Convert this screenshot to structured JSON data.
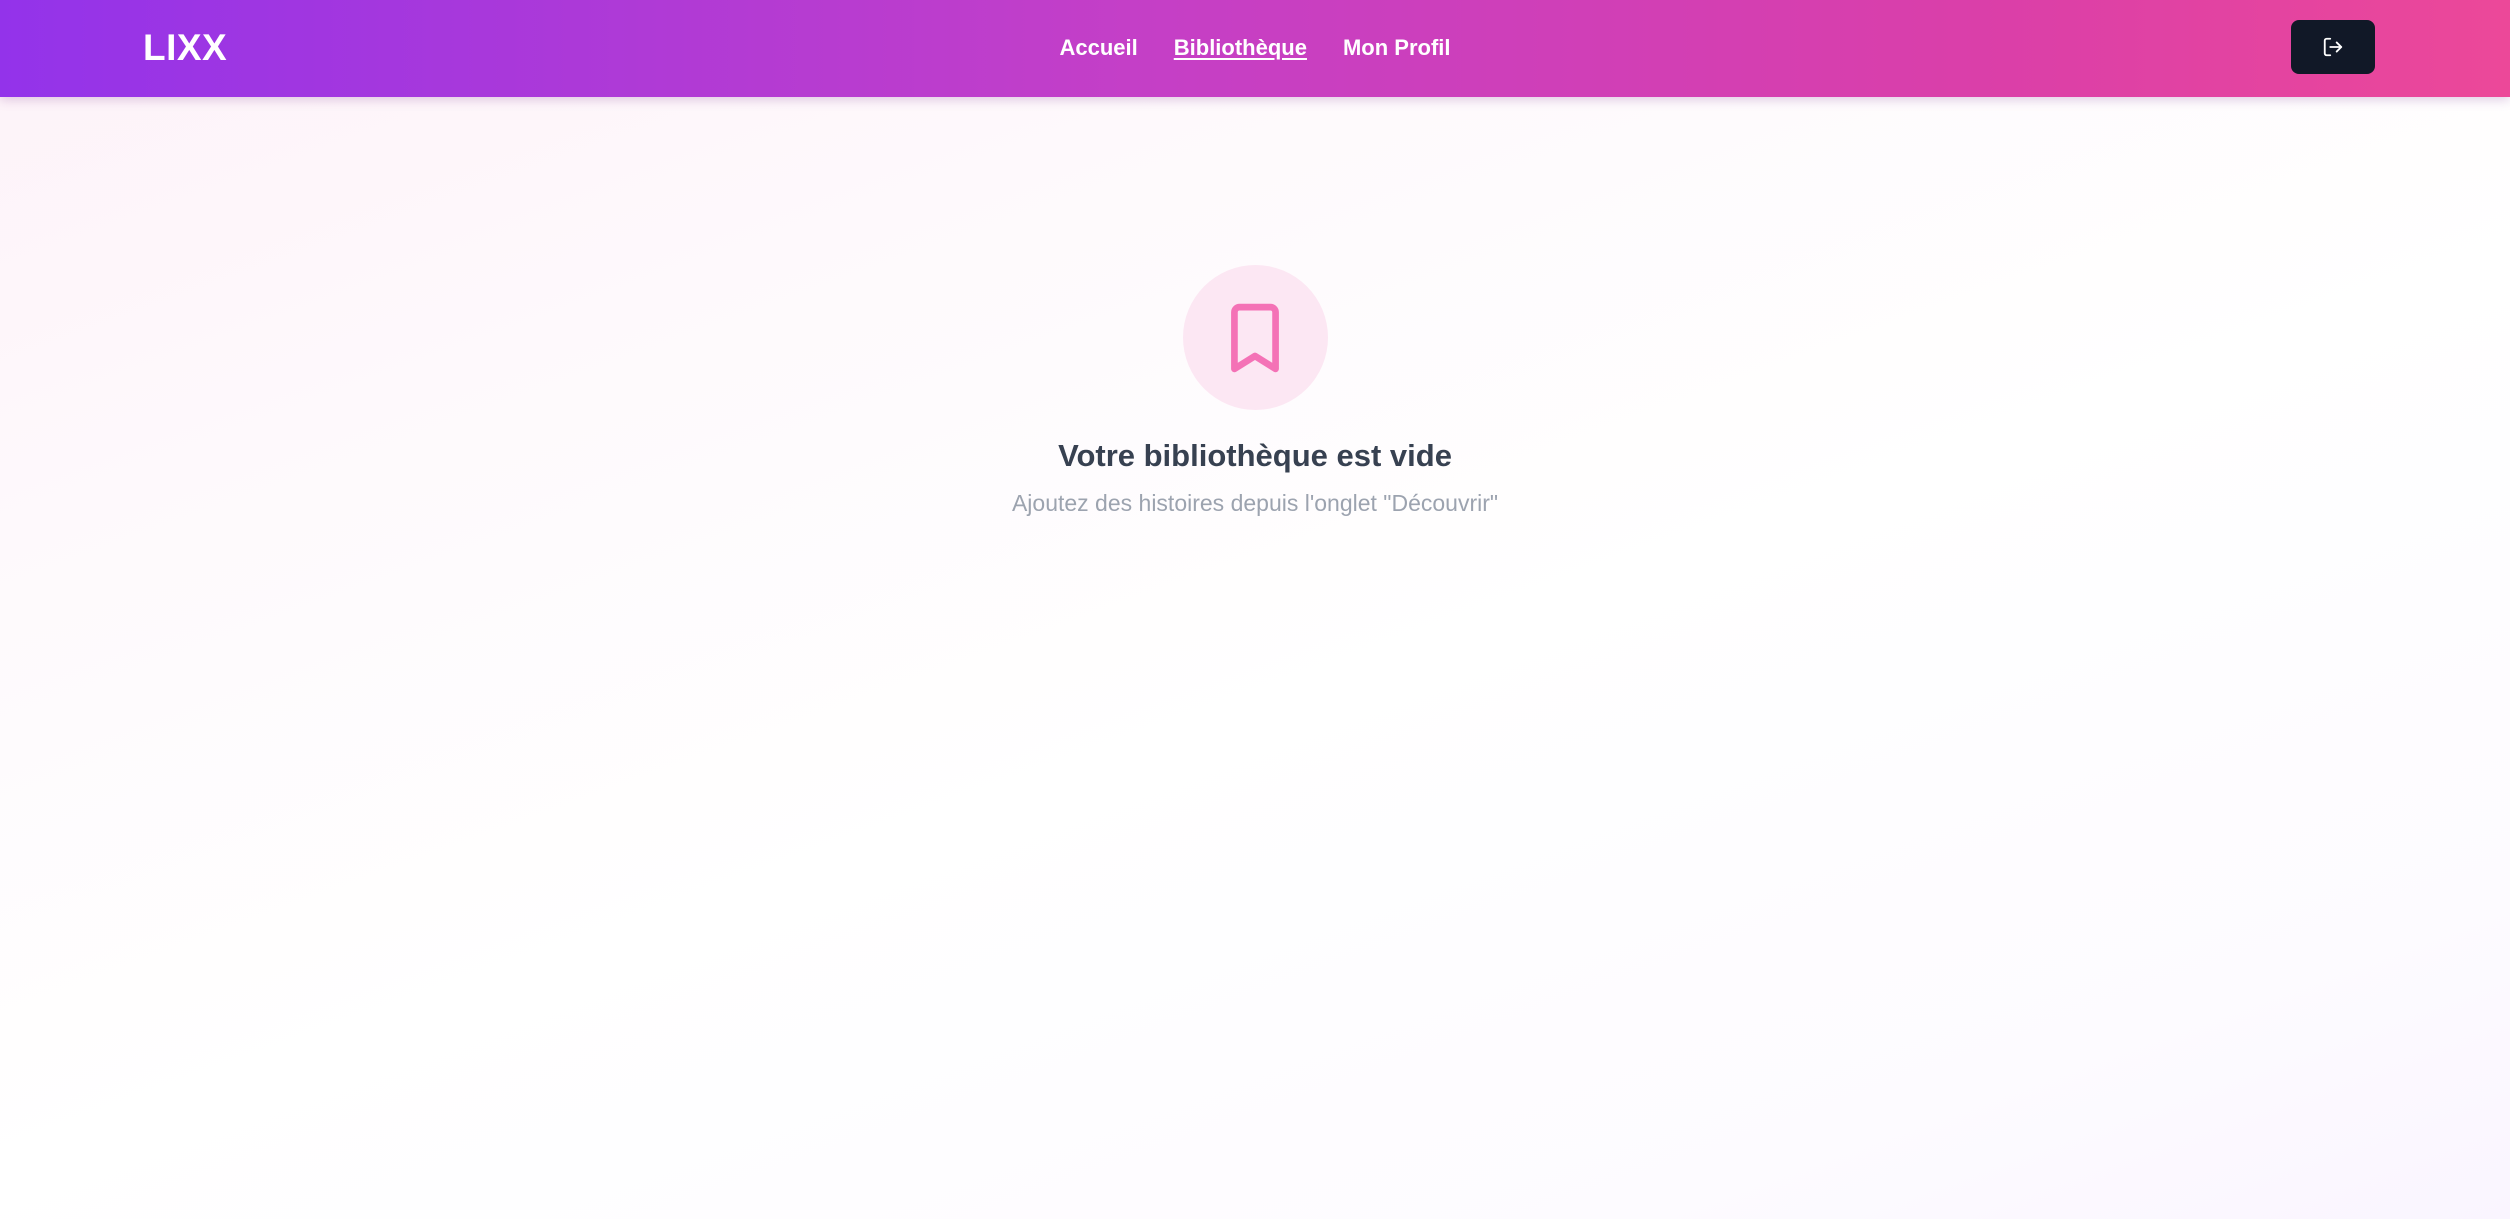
{
  "header": {
    "logo": "LIXX",
    "nav": [
      {
        "label": "Accueil",
        "active": false
      },
      {
        "label": "Bibliothèque",
        "active": true
      },
      {
        "label": "Mon Profil",
        "active": false
      }
    ],
    "logout_icon": "logout-icon"
  },
  "main": {
    "empty_icon": "bookmark-icon",
    "empty_title": "Votre bibliothèque est vide",
    "empty_subtitle": "Ajoutez des histoires depuis l'onglet \"Découvrir\""
  },
  "colors": {
    "gradient_start": "#9333ea",
    "gradient_end": "#ec4899",
    "icon_accent": "#f472b6",
    "icon_bg": "#fce7f3",
    "logout_bg": "#111827"
  }
}
